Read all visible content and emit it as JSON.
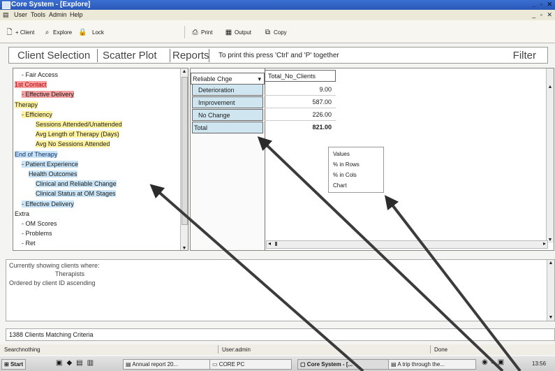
{
  "window": {
    "title": "Core System - [Explore]",
    "controls_top": "_|&#9633;|x"
  },
  "menu": [
    "User",
    "Tools",
    "Admin",
    "Help"
  ],
  "toolbar": {
    "new_client": "+ Client",
    "explore": "Explore",
    "lock": "Lock",
    "print": "Print",
    "output": "Output",
    "copy": "Copy"
  },
  "tabs": {
    "client_selection": "Client Selection",
    "scatter_plot": "Scatter Plot",
    "reports": "Reports",
    "note": "To print this press 'Ctrl' and 'P' together",
    "filter": "Filter"
  },
  "tree": [
    {
      "label": "- Fair Access",
      "indent": 1,
      "style": "plain"
    },
    {
      "label": "1st Contact",
      "indent": 0,
      "style": "red"
    },
    {
      "label": "- Effective Delivery",
      "indent": 1,
      "style": "red"
    },
    {
      "label": "Therapy",
      "indent": 0,
      "style": "yellow"
    },
    {
      "label": "- Efficiency",
      "indent": 1,
      "style": "yellow"
    },
    {
      "label": "Sessions Attended/Unattended",
      "indent": 3,
      "style": "yellow"
    },
    {
      "label": "Avg Length of Therapy (Days)",
      "indent": 3,
      "style": "yellow"
    },
    {
      "label": "Avg No Sessions Attended",
      "indent": 3,
      "style": "yellow"
    },
    {
      "label": "End of Therapy",
      "indent": 0,
      "style": "blue"
    },
    {
      "label": "- Patient Experience",
      "indent": 1,
      "style": "blue"
    },
    {
      "label": "Health Outcomes",
      "indent": 2,
      "style": "blue"
    },
    {
      "label": "Clinical and Reliable Change",
      "indent": 3,
      "style": "blue"
    },
    {
      "label": "Clinical Status at OM Stages",
      "indent": 3,
      "style": "blue"
    },
    {
      "label": "- Effective Delivery",
      "indent": 1,
      "style": "blue"
    },
    {
      "label": "Extra",
      "indent": 0,
      "style": "plain"
    },
    {
      "label": "- OM Scores",
      "indent": 1,
      "style": "plain"
    },
    {
      "label": "- Problems",
      "indent": 1,
      "style": "plain"
    },
    {
      "label": "- Ret",
      "indent": 1,
      "style": "plain"
    }
  ],
  "pivot": {
    "row_header": "Reliable Chge",
    "col_header": "Total_No_Clients",
    "rows": [
      {
        "label": "Deterioration",
        "value": "9.00"
      },
      {
        "label": "Improvement",
        "value": "587.00"
      },
      {
        "label": "No Change",
        "value": "226.00"
      }
    ],
    "total_label": "Total",
    "total_value": "821.00"
  },
  "context_menu": [
    "Values",
    "% in Rows",
    "% in Cols",
    "Chart"
  ],
  "summary": {
    "line1": "Currently showing clients where:",
    "line2": "Therapists",
    "line3": "Ordered by client ID ascending"
  },
  "count_label": "1388 Clients Matching Criteria",
  "status": {
    "left": "Searchnothing",
    "user": "User:admin",
    "state": "Done"
  },
  "taskbar": {
    "start": "Start",
    "items": [
      "Annual report 20...",
      "CORE PC",
      "Core System - [...",
      "A trip through the..."
    ],
    "clock": "13:56"
  }
}
